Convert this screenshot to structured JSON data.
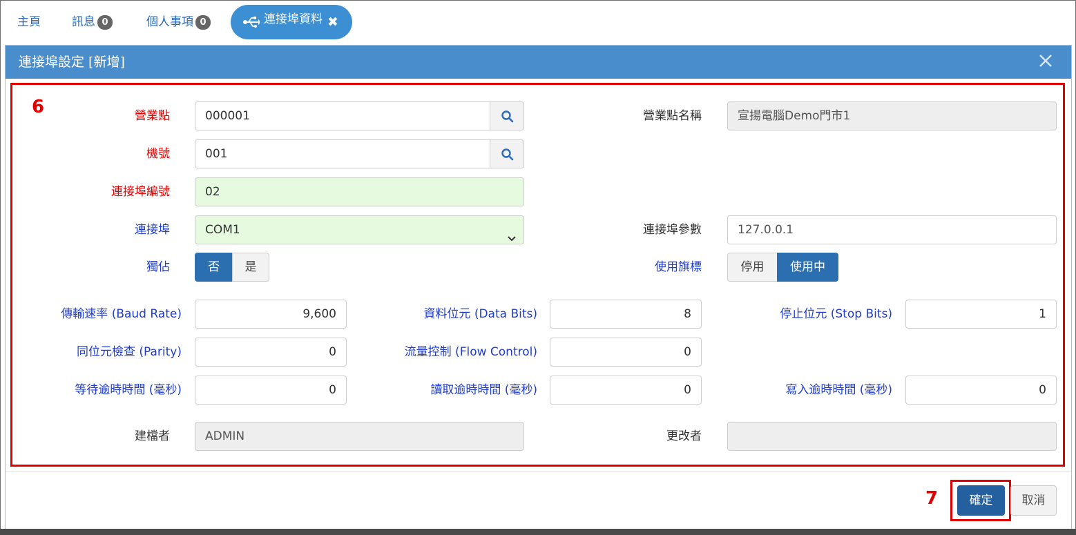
{
  "tabs": {
    "home": "主頁",
    "messages": "訊息",
    "messages_count": "0",
    "personal": "個人事項",
    "personal_count": "0",
    "active": "連接埠資料",
    "active_icon": "usb-icon",
    "close_icon": "close-icon"
  },
  "modal": {
    "title": "連接埠設定 [新增]",
    "close_icon": "close-icon"
  },
  "annotations": {
    "form_marker": "6",
    "confirm_marker": "7",
    "highlight_color": "#e00000"
  },
  "form": {
    "store_label": "營業點",
    "store_value": "000001",
    "store_name_label": "營業點名稱",
    "store_name_value": "宣揚電腦Demo門市1",
    "machine_label": "機號",
    "machine_value": "001",
    "port_no_label": "連接埠編號",
    "port_no_value": "02",
    "port_label": "連接埠",
    "port_value": "COM1",
    "port_params_label": "連接埠參數",
    "port_params_value": "127.0.0.1",
    "exclusive_label": "獨佔",
    "exclusive_options": [
      "否",
      "是"
    ],
    "exclusive_selected": "否",
    "use_flag_label": "使用旗標",
    "use_flag_options": [
      "停用",
      "使用中"
    ],
    "use_flag_selected": "使用中",
    "baud_label": "傳輸速率 (Baud Rate)",
    "baud_value": "9,600",
    "data_bits_label": "資料位元 (Data Bits)",
    "data_bits_value": "8",
    "stop_bits_label": "停止位元 (Stop Bits)",
    "stop_bits_value": "1",
    "parity_label": "同位元檢查 (Parity)",
    "parity_value": "0",
    "flow_label": "流量控制 (Flow Control)",
    "flow_value": "0",
    "wait_timeout_label": "等待逾時時間 (毫秒)",
    "wait_timeout_value": "0",
    "read_timeout_label": "讀取逾時時間 (毫秒)",
    "read_timeout_value": "0",
    "write_timeout_label": "寫入逾時時間 (毫秒)",
    "write_timeout_value": "0",
    "creator_label": "建檔者",
    "creator_value": "ADMIN",
    "modifier_label": "更改者",
    "modifier_value": ""
  },
  "footer": {
    "confirm": "確定",
    "cancel": "取消"
  },
  "colors": {
    "header_blue": "#4a8dcc",
    "active_tab": "#3b8fd2",
    "required_red": "#e00000",
    "label_blue": "#1f3ccc",
    "toggle_on": "#2b6fb0",
    "confirm_button": "#245f9e",
    "green_field": "#e6fae0"
  }
}
